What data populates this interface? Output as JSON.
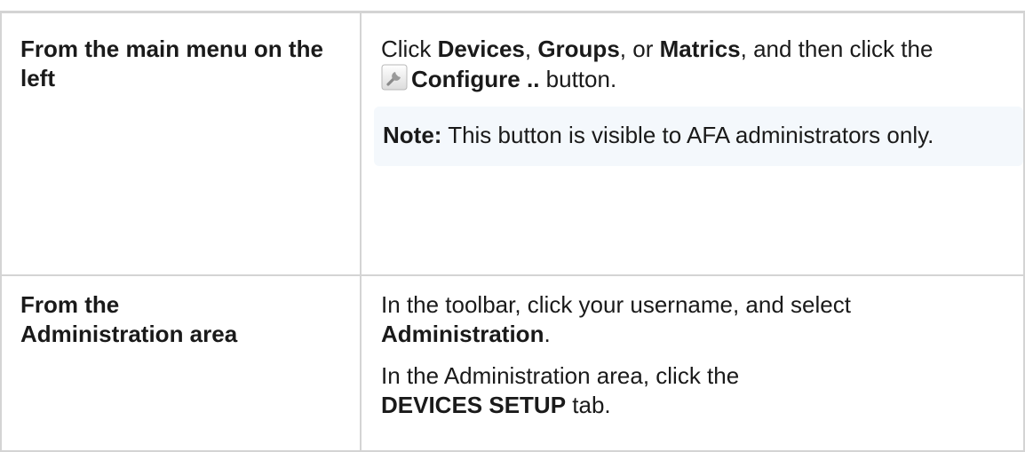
{
  "rows": [
    {
      "location": "From the main menu on the left",
      "steps": {
        "prefix": "Click ",
        "item1": "Devices",
        "sep1": ", ",
        "item2": "Groups",
        "sep2": ", or ",
        "item3": "Matrics",
        "suffix": ", and then click the",
        "button_icon": "wrench-icon",
        "button_label": "Configure ..",
        "button_suffix": " button."
      },
      "note": {
        "label": "Note:",
        "text": " This button is visible to AFA administrators only."
      }
    },
    {
      "location_line1": "From the",
      "location_line2": "Administration area",
      "step1_prefix": "In the toolbar, click your username, and select ",
      "step1_item": "Administration",
      "step1_suffix": ".",
      "step2_prefix": "In the Administration area, click the ",
      "step2_item": "DEVICES SETUP",
      "step2_suffix": " tab."
    }
  ]
}
